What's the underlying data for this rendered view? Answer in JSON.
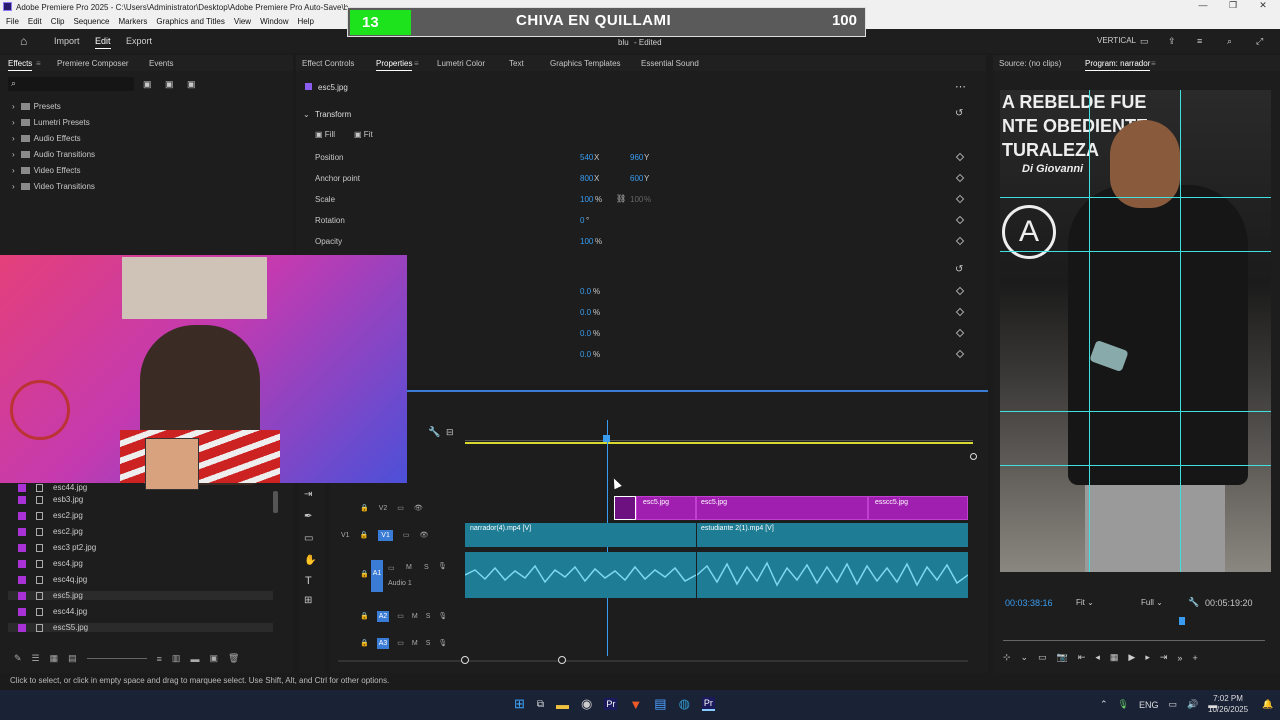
{
  "titlebar": {
    "text": "Adobe Premiere Pro 2025 - C:\\Users\\Administrator\\Desktop\\Adobe Premiere Pro Auto-Save\\b"
  },
  "menu": [
    "File",
    "Edit",
    "Clip",
    "Sequence",
    "Markers",
    "Graphics and Titles",
    "View",
    "Window",
    "Help"
  ],
  "scoreboard": {
    "number": "13",
    "team": "CHIVA EN QUILLAMI",
    "points": "100"
  },
  "topbar": {
    "import": "Import",
    "edit": "Edit",
    "export": "Export",
    "doc_title": "blu",
    "doc_status": "- Edited",
    "workspace": "VERTICAL"
  },
  "effects_panel": {
    "tabs": [
      "Effects",
      "Premiere Composer",
      "Events"
    ],
    "items": [
      "Presets",
      "Lumetri Presets",
      "Audio Effects",
      "Audio Transitions",
      "Video Effects",
      "Video Transitions"
    ]
  },
  "props_panel": {
    "tabs": [
      "Effect Controls",
      "Properties",
      "Lumetri Color",
      "Text",
      "Graphics Templates",
      "Essential Sound"
    ],
    "clip": "esc5.jpg",
    "section": "Transform",
    "fill": "Fill",
    "fit": "Fit",
    "position_label": "Position",
    "position_x": "540",
    "position_y": "960",
    "anchor_label": "Anchor point",
    "anchor_x": "800",
    "anchor_y": "600",
    "scale_label": "Scale",
    "scale": "100",
    "scale_linked": "100",
    "rotation_label": "Rotation",
    "rotation": "0",
    "opacity_label": "Opacity",
    "opacity": "100",
    "extra_values": [
      "0.0",
      "0.0",
      "0.0",
      "0.0"
    ],
    "x": "X",
    "y": "Y",
    "pct": "%",
    "deg": "°"
  },
  "project": {
    "items": [
      "esc44.jpg",
      "esb3.jpg",
      "esc2.jpg",
      "esc2.jpg",
      "esc3 pt2.jpg",
      "esc4.jpg",
      "esc4q.jpg",
      "esc5.jpg",
      "esc44.jpg",
      "escS5.jpg"
    ]
  },
  "timeline": {
    "tracks": {
      "v2": "V2",
      "v1": "V1",
      "a1": "A1",
      "audio1": "Audio 1",
      "a2": "A2",
      "a3": "A3"
    },
    "clips_v2": [
      "esc5.jpg",
      "esc5.jpg",
      "esscc5.jpg"
    ],
    "clips_v1": [
      "narrador(4).mp4 [V]",
      "estudiante 2(1).mp4 [V]"
    ]
  },
  "program": {
    "source_tab": "Source: (no clips)",
    "program_tab": "Program: narrador",
    "timecode": "00:03:38:16",
    "fit": "Fit",
    "full": "Full",
    "duration": "00:05:19:20",
    "poster_lines": [
      "A REBELDE FUE",
      "NTE OBEDIENTE",
      "TURALEZA",
      "Di Giovanni"
    ]
  },
  "status": "Click to select, or click in empty space and drag to marquee select. Use Shift, Alt, and Ctrl for other options.",
  "taskbar": {
    "lang": "ENG",
    "time": "7:02 PM",
    "date": "10/26/2025"
  },
  "colors": {
    "accent": "#3a9cf0",
    "video_clip": "#a01eb0",
    "audio_clip": "#1e7d95",
    "score_green": "#1ce31c"
  }
}
